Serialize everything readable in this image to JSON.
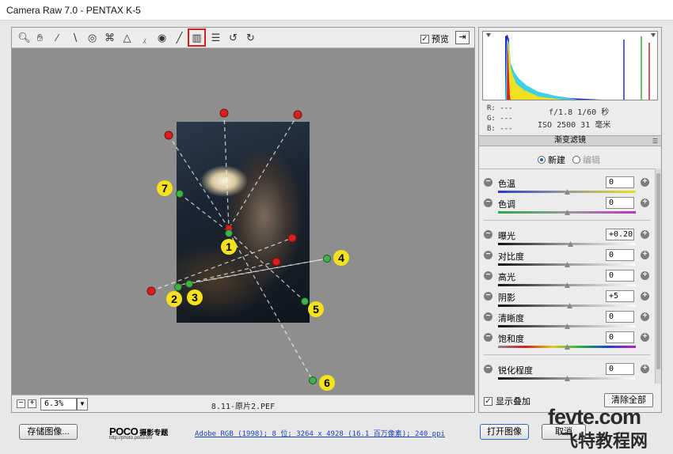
{
  "window": {
    "title": "Camera Raw 7.0 -  PENTAX K-5"
  },
  "toolbar": {
    "tools": [
      "zoom-icon",
      "hand-icon",
      "white-balance-icon",
      "color-sampler-icon",
      "target-adjust-icon",
      "crop-icon",
      "straighten-icon",
      "spot-removal-icon",
      "red-eye-icon",
      "adjustment-brush-icon",
      "graduated-filter-icon",
      "preferences-icon",
      "rotate-left-icon",
      "rotate-right-icon"
    ],
    "active_tool": "graduated-filter-icon",
    "preview_label": "预览",
    "preview_checked": true
  },
  "canvas": {
    "markers": [
      "1",
      "2",
      "3",
      "4",
      "5",
      "6",
      "7"
    ],
    "marker_color": "#f5e21c",
    "pin_red": "#d81f1f",
    "pin_green": "#3fb34a"
  },
  "zoom": {
    "value": "6.3%"
  },
  "footer_image": {
    "filename": "8.11-原片2.PEF"
  },
  "exif": {
    "r": "R:  ---",
    "g": "G:  ---",
    "b": "B:  ---",
    "aperture_shutter": "f/1.8   1/60 秒",
    "iso_focal": "ISO 2500   31 毫米"
  },
  "panel": {
    "title": "渐变滤镜",
    "mode_new": "新建",
    "mode_edit": "编辑",
    "sliders": [
      {
        "label": "色温",
        "value": "0"
      },
      {
        "label": "色调",
        "value": "0"
      },
      {
        "label": "曝光",
        "value": "+0.20"
      },
      {
        "label": "对比度",
        "value": "0"
      },
      {
        "label": "高光",
        "value": "0"
      },
      {
        "label": "阴影",
        "value": "+5"
      },
      {
        "label": "清晰度",
        "value": "0"
      },
      {
        "label": "饱和度",
        "value": "0"
      },
      {
        "label": "锐化程度",
        "value": "0"
      }
    ],
    "show_overlay_label": "显示叠加",
    "show_overlay_checked": true,
    "clear_all_label": "清除全部"
  },
  "bottom": {
    "save_label": "存储图像...",
    "logo_text": "POCO",
    "logo_tag": "摄影专题",
    "logo_url": "http://photo.poco.cn/",
    "workflow": "Adobe RGB (1998); 8 位; 3264 x 4928 (16.1 百万像素); 240 ppi",
    "open_label": "打开图像",
    "cancel_label": "取消"
  },
  "watermark": {
    "top": "fevte.com",
    "bottom": "飞特教程网"
  }
}
